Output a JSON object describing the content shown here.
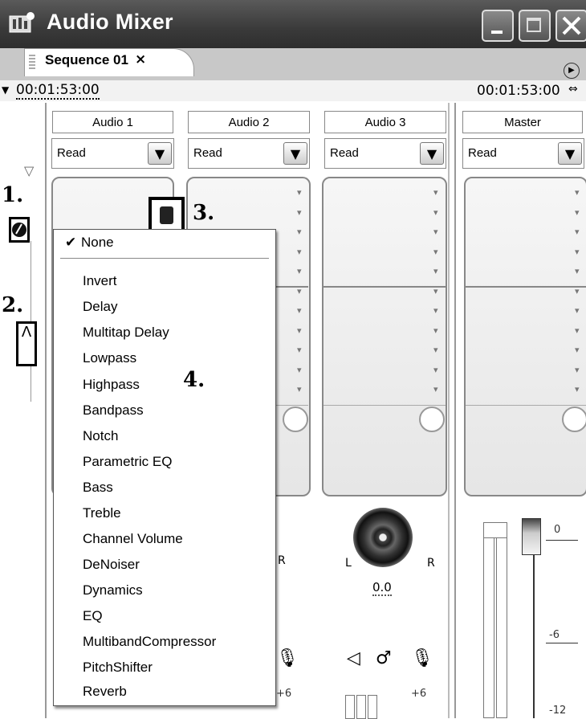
{
  "window": {
    "title": "Audio Mixer",
    "app_icon": "premiere-mixer-icon"
  },
  "window_buttons": [
    "minimize",
    "maximize",
    "close"
  ],
  "tab": {
    "label": "Sequence 01",
    "close": "×"
  },
  "timecode": {
    "current": "00:01:53:00",
    "duration": "00:01:53:00"
  },
  "annotations": {
    "one": "1.",
    "two": "2.",
    "three": "3.",
    "four": "4."
  },
  "tracks": [
    {
      "name": "Audio 1",
      "mode": "Read"
    },
    {
      "name": "Audio 2",
      "mode": "Read"
    },
    {
      "name": "Audio 3",
      "mode": "Read"
    },
    {
      "name": "Master",
      "mode": "Read"
    }
  ],
  "effects_menu": {
    "checked_item": "None",
    "items": [
      "Invert",
      "Delay",
      "Multitap Delay",
      "Lowpass",
      "Highpass",
      "Bandpass",
      "Notch",
      "Parametric EQ",
      "Bass",
      "Treble",
      "Channel Volume",
      "DeNoiser",
      "Dynamics",
      "EQ",
      "MultibandCompressor",
      "PitchShifter",
      "Reverb"
    ]
  },
  "pan": {
    "left": "L",
    "right": "R",
    "value": "0.0"
  },
  "meter": {
    "top": "0",
    "mid": "-6",
    "low": "-12",
    "plus": "+6",
    "plus2": "+6"
  }
}
